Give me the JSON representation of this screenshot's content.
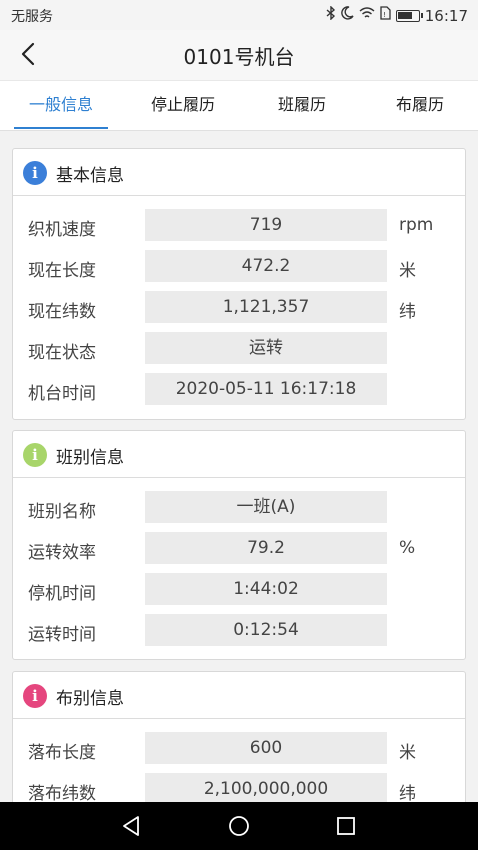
{
  "status_bar": {
    "carrier": "无服务",
    "time": "16:17",
    "icons": [
      "bluetooth-icon",
      "moon-icon",
      "wifi-icon",
      "sim-icon",
      "battery-icon"
    ]
  },
  "nav": {
    "title": "0101号机台",
    "back_icon": "back-chevron-icon"
  },
  "tabs": [
    {
      "label": "一般信息",
      "active": true
    },
    {
      "label": "停止履历",
      "active": false
    },
    {
      "label": "班履历",
      "active": false
    },
    {
      "label": "布履历",
      "active": false
    }
  ],
  "colors": {
    "accent": "#2f80d1",
    "icon_basic": "#3b7fd9",
    "icon_shift": "#a8d56a",
    "icon_cloth": "#e5467e"
  },
  "sections": {
    "basic": {
      "title": "基本信息",
      "rows": [
        {
          "label": "织机速度",
          "value": "719",
          "unit": "rpm"
        },
        {
          "label": "现在长度",
          "value": "472.2",
          "unit": "米"
        },
        {
          "label": "现在纬数",
          "value": "1,121,357",
          "unit": "纬"
        },
        {
          "label": "现在状态",
          "value": "运转",
          "unit": ""
        },
        {
          "label": "机台时间",
          "value": "2020-05-11 16:17:18",
          "unit": ""
        }
      ]
    },
    "shift": {
      "title": "班别信息",
      "rows": [
        {
          "label": "班别名称",
          "value": "一班(A)",
          "unit": ""
        },
        {
          "label": "运转效率",
          "value": "79.2",
          "unit": "%"
        },
        {
          "label": "停机时间",
          "value": "1:44:02",
          "unit": ""
        },
        {
          "label": "运转时间",
          "value": "0:12:54",
          "unit": ""
        }
      ]
    },
    "cloth": {
      "title": "布别信息",
      "rows": [
        {
          "label": "落布长度",
          "value": "600",
          "unit": "米"
        },
        {
          "label": "落布纬数",
          "value": "2,100,000,000",
          "unit": "纬"
        }
      ]
    }
  },
  "system_nav": [
    "back-triangle-icon",
    "home-circle-icon",
    "recents-square-icon"
  ]
}
